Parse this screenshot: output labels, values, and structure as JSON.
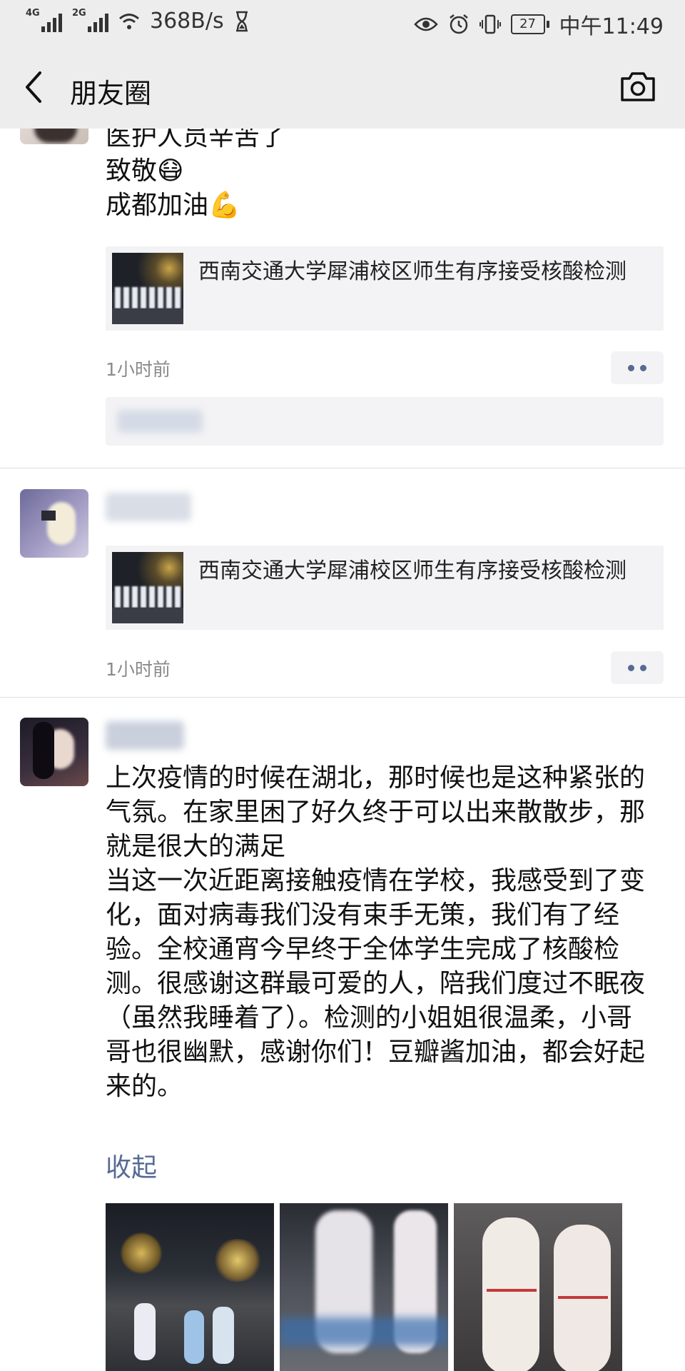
{
  "status_bar": {
    "net1": "4G",
    "net2": "2G",
    "speed": "368B/s",
    "battery": "27",
    "time": "中午11:49"
  },
  "nav": {
    "title": "朋友圈",
    "back_icon": "chevron-left-icon",
    "camera_icon": "camera-icon"
  },
  "posts": [
    {
      "text": "医护人员辛苦了\n致敬😷\n成都加油💪",
      "link": {
        "title": "西南交通大学犀浦校区师生有序接受核酸检测"
      },
      "time": "1小时前"
    },
    {
      "link": {
        "title": "西南交通大学犀浦校区师生有序接受核酸检测"
      },
      "time": "1小时前"
    },
    {
      "text": "上次疫情的时候在湖北，那时候也是这种紧张的气氛。在家里困了好久终于可以出来散散步，那就是很大的满足\n当这一次近距离接触疫情在学校，我感受到了变化，面对病毒我们没有束手无策，我们有了经验。全校通宵今早终于全体学生完成了核酸检测。很感谢这群最可爱的人，陪我们度过不眠夜（虽然我睡着了）。检测的小姐姐很温柔，小哥哥也很幽默，感谢你们！豆瓣酱加油，都会好起来的。",
      "collapse": "收起"
    }
  ]
}
